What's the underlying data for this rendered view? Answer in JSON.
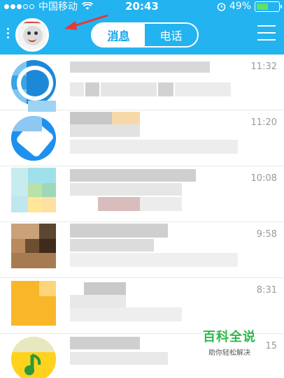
{
  "status_bar": {
    "carrier": "中国移动",
    "time": "20:43",
    "battery": "49%"
  },
  "nav": {
    "tabs": [
      {
        "label": "消息",
        "active": true
      },
      {
        "label": "电话",
        "active": false
      }
    ],
    "menu_icon": "hamburger-menu-icon"
  },
  "conversations": [
    {
      "name": "…",
      "message": "…",
      "time": "11:32"
    },
    {
      "name": "…",
      "message": "…",
      "time": "11:20"
    },
    {
      "name": "…",
      "message": "…",
      "time": "10:08"
    },
    {
      "name": "…",
      "message": "…",
      "time": "9:58"
    },
    {
      "name": "…",
      "message": "…",
      "time": "8:31"
    },
    {
      "name": "…",
      "message": "…",
      "time": "15"
    }
  ],
  "watermark": {
    "title": "百科全说",
    "subtitle": "助你轻松解决"
  },
  "colors": {
    "header": "#23b3f0",
    "accent_arrow": "#e53935",
    "watermark_green": "#2fb84a"
  }
}
